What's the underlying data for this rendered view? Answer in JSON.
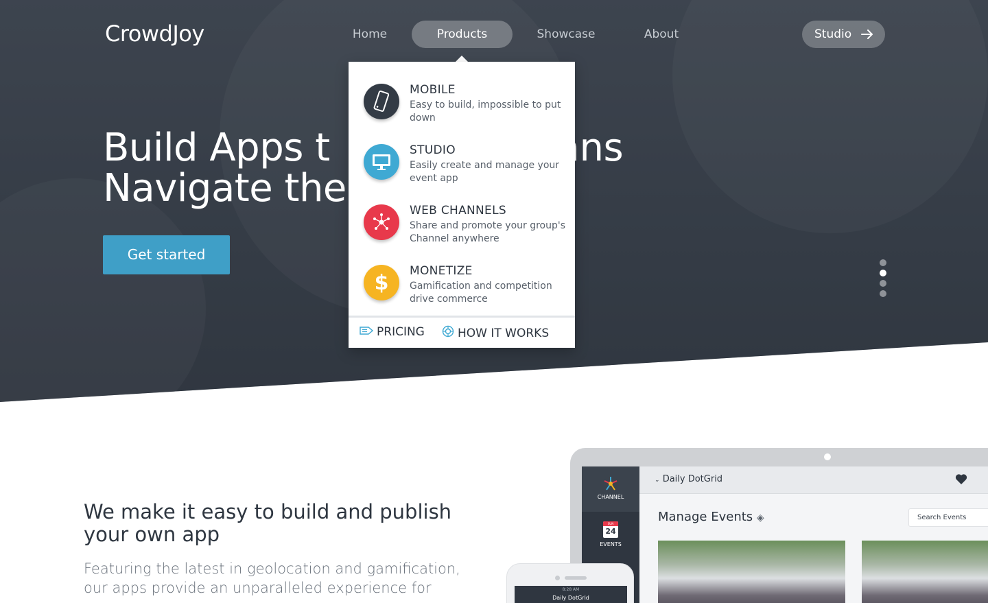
{
  "brand": {
    "logo": "CrowdJoy"
  },
  "nav": {
    "items": [
      {
        "label": "Home",
        "active": false
      },
      {
        "label": "Products",
        "active": true
      },
      {
        "label": "Showcase",
        "active": false
      },
      {
        "label": "About",
        "active": false
      }
    ],
    "studio_button": "Studio"
  },
  "hero": {
    "headline_line1": "Build Apps t",
    "headline_line1_end": "ans",
    "headline_line2": "Navigate the",
    "cta": "Get started",
    "slide_count": 4,
    "active_slide": 2
  },
  "products_menu": {
    "items": [
      {
        "title": "MOBILE",
        "desc": "Easy to build, impossible to put down",
        "icon": "mobile-phone-icon",
        "color": "#333b45"
      },
      {
        "title": "STUDIO",
        "desc": "Easily create and manage your event app",
        "icon": "desktop-monitor-icon",
        "color": "#3fa9d3"
      },
      {
        "title": "WEB CHANNELS",
        "desc": "Share and promote your group's Channel anywhere",
        "icon": "network-hub-icon",
        "color": "#e8394b"
      },
      {
        "title": "MONETIZE",
        "desc": "Gamification and competition drive commerce",
        "icon": "dollar-icon",
        "color": "#f6b422"
      }
    ],
    "footer": {
      "pricing": "PRICING",
      "how_it_works": "HOW IT WORKS"
    }
  },
  "intro": {
    "title": "We make it easy to build and publish your own app",
    "body": "Featuring the latest in geolocation and gamification, our apps provide an unparalleled experience for"
  },
  "mockup": {
    "channel_label": "CHANNEL",
    "events_label": "EVENTS",
    "calendar_day": "24",
    "calendar_month": "SUN",
    "doc_name": "Daily DotGrid",
    "manage_title": "Manage Events",
    "search_placeholder": "Search Events",
    "phone_time": "8:28 AM",
    "phone_title": "Daily DotGrid"
  },
  "colors": {
    "accent": "#3f9fc7",
    "hero_bg": "#3f4651",
    "text_dark": "#2e3640"
  }
}
